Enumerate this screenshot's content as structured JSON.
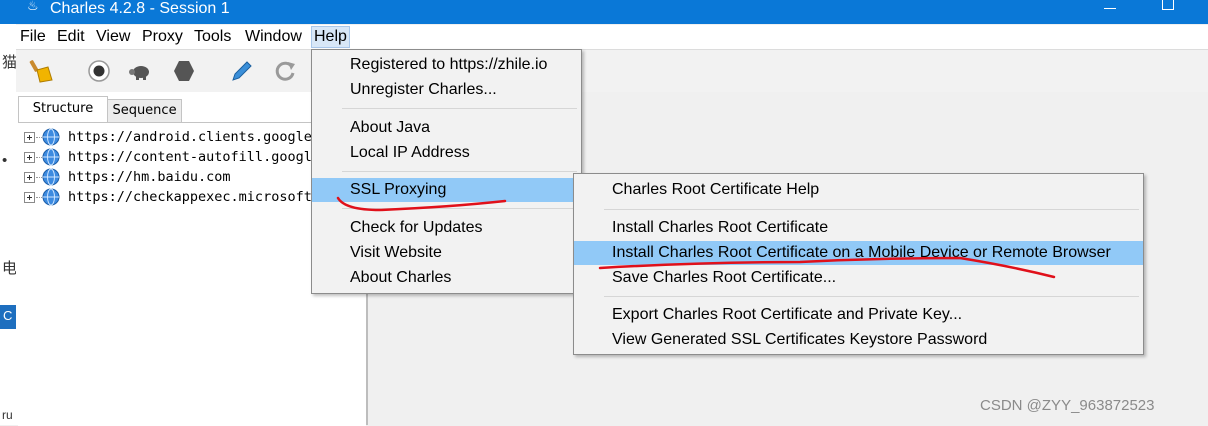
{
  "window": {
    "title": "Charles 4.2.8 - Session 1",
    "icon": "charles-pot-icon"
  },
  "menubar": {
    "items": [
      "File",
      "Edit",
      "View",
      "Proxy",
      "Tools",
      "Window",
      "Help"
    ],
    "active": "Help"
  },
  "toolbar": {
    "icons": [
      "broom-icon",
      "record-icon",
      "throttle-turtle-icon",
      "breakpoint-hexagon-icon",
      "compose-pen-icon",
      "repeat-icon"
    ]
  },
  "tabs": [
    "Structure",
    "Sequence"
  ],
  "tree": {
    "items": [
      "https://android.clients.google.",
      "https://content-autofill.googl",
      "https://hm.baidu.com",
      "https://checkappexec.microsoft."
    ]
  },
  "help_menu": {
    "items": [
      "Registered to https://zhile.io",
      "Unregister Charles...",
      "About Java",
      "Local IP Address",
      "SSL Proxying",
      "Check for Updates",
      "Visit Website",
      "About Charles"
    ],
    "highlighted": "SSL Proxying",
    "submenu_arrow": "›"
  },
  "ssl_submenu": {
    "items": [
      "Charles Root Certificate Help",
      "Install Charles Root Certificate",
      "Install Charles Root Certificate on a Mobile Device or Remote Browser",
      "Save Charles Root Certificate...",
      "Export Charles Root Certificate and Private Key...",
      "View Generated SSL Certificates Keystore Password"
    ],
    "highlighted": "Install Charles Root Certificate on a Mobile Device or Remote Browser"
  },
  "background_window": {
    "glyphs": [
      "猫",
      "•",
      "电",
      "C",
      "ru"
    ]
  },
  "watermark": "CSDN @ZYY_963872523",
  "colors": {
    "titlebar": "#0a78d7",
    "highlight": "#91c9f7",
    "annotation": "#e0101a"
  }
}
